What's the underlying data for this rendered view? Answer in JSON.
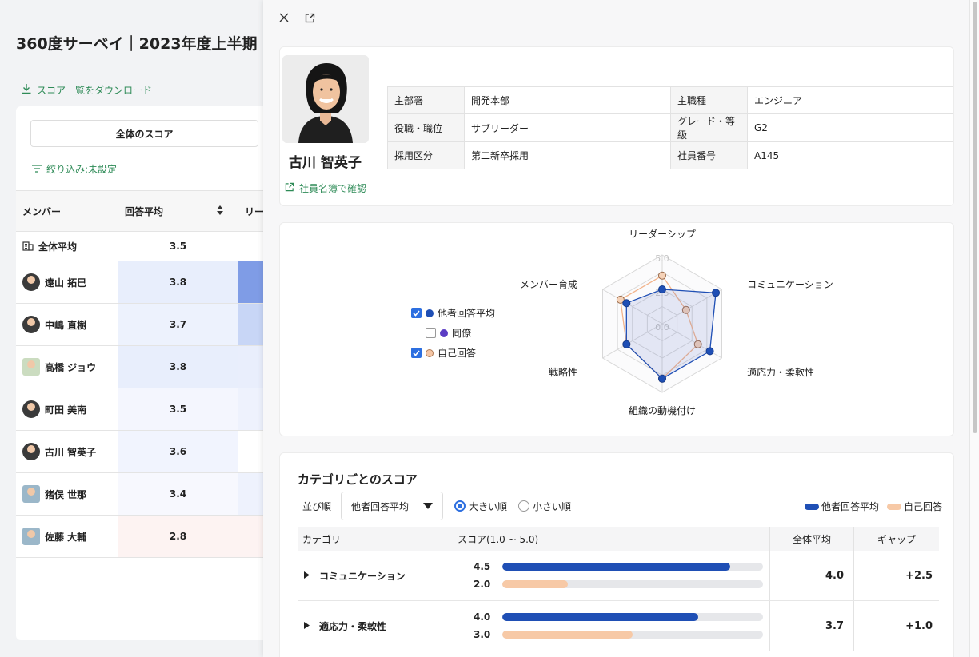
{
  "background": {
    "title": "360度サーベイ｜2023年度上半期",
    "download_label": "スコア一覧をダウンロード",
    "tab_label": "全体のスコア",
    "filter_label": "絞り込み:未設定",
    "table": {
      "col_member": "メンバー",
      "col_avg": "回答平均",
      "col_leader": "リー",
      "overall": {
        "name": "全体平均",
        "value": "3.5"
      },
      "rows": [
        {
          "name": "遠山 拓巳",
          "value": "3.8",
          "tint": "#e8eefc",
          "cell3": "#7f9ce6"
        },
        {
          "name": "中嶋 直樹",
          "value": "3.7",
          "tint": "#edf2fd",
          "cell3": "#c8d6f6"
        },
        {
          "name": "高橋 ジョウ",
          "value": "3.8",
          "tint": "#e8eefc",
          "cell3": "#e9eefc"
        },
        {
          "name": "町田 美南",
          "value": "3.5",
          "tint": "#f4f6fe",
          "cell3": "#eef2fd"
        },
        {
          "name": "古川 智英子",
          "value": "3.6",
          "tint": "#f1f4fe",
          "cell3": "#ffffff"
        },
        {
          "name": "猪俣 世那",
          "value": "3.4",
          "tint": "#f7f8fe",
          "cell3": "#eef2fd"
        },
        {
          "name": "佐藤 大輔",
          "value": "2.8",
          "tint": "#fdf3f2",
          "cell3": "#fdf3f2"
        }
      ]
    }
  },
  "profile": {
    "name": "古川 智英子",
    "link_label": "社員名簿で確認",
    "fields": [
      {
        "k1": "主部署",
        "v1": "開発本部",
        "k2": "主職種",
        "v2": "エンジニア"
      },
      {
        "k1": "役職・職位",
        "v1": "サブリーダー",
        "k2": "グレード・等級",
        "v2": "G2"
      },
      {
        "k1": "採用区分",
        "v1": "第二新卒採用",
        "k2": "社員番号",
        "v2": "A145"
      }
    ]
  },
  "radar": {
    "axes": [
      "リーダーシップ",
      "コミュニケーション",
      "適応力・柔軟性",
      "組織の動機付け",
      "戦略性",
      "メンバー育成"
    ],
    "ticks": [
      "5.0",
      "2.5",
      "0.0"
    ],
    "max": 5,
    "legend": [
      {
        "label": "他者回答平均",
        "checked": true,
        "color": "#1f4fb5"
      },
      {
        "label": "同僚",
        "checked": false,
        "color": "#5b3cc4"
      },
      {
        "label": "自己回答",
        "checked": true,
        "color": "#f5c6a5"
      }
    ],
    "others": [
      2.5,
      4.5,
      4.0,
      4.0,
      3.0,
      3.0
    ],
    "self": [
      3.5,
      2.0,
      3.0,
      4.0,
      3.0,
      3.5
    ]
  },
  "categories": {
    "title": "カテゴリごとのスコア",
    "sort_label": "並び順",
    "sort_value": "他者回答平均",
    "order_desc": "大きい順",
    "order_asc": "小さい順",
    "legend_others": "他者回答平均",
    "legend_self": "自己回答",
    "col_category": "カテゴリ",
    "col_score": "スコア(1.0 ~ 5.0)",
    "col_overall": "全体平均",
    "col_gap": "ギャップ",
    "color_others": "#1f4fb5",
    "color_self": "#f7c9a6",
    "rows": [
      {
        "name": "コミュニケーション",
        "others": "4.5",
        "self": "2.0",
        "others_level": 0.875,
        "self_level": 0.25,
        "overall": "4.0",
        "gap": "+2.5"
      },
      {
        "name": "適応力・柔軟性",
        "others": "4.0",
        "self": "3.0",
        "others_level": 0.75,
        "self_level": 0.5,
        "overall": "3.7",
        "gap": "+1.0"
      }
    ]
  }
}
